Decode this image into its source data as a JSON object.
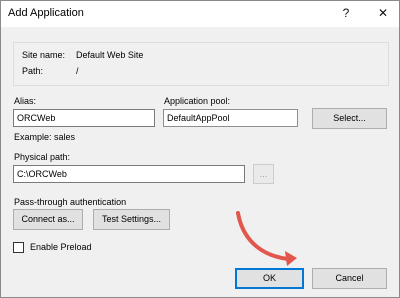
{
  "window": {
    "title": "Add Application",
    "help_glyph": "?",
    "close_glyph": "✕"
  },
  "site_info": {
    "site_name_label": "Site name:",
    "site_name_value": "Default Web Site",
    "path_label": "Path:",
    "path_value": "/"
  },
  "alias": {
    "label": "Alias:",
    "value": "ORCWeb",
    "example": "Example: sales"
  },
  "app_pool": {
    "label": "Application pool:",
    "value": "DefaultAppPool",
    "select_button": "Select..."
  },
  "physical_path": {
    "label": "Physical path:",
    "value": "C:\\ORCWeb",
    "browse_button": "..."
  },
  "auth": {
    "label": "Pass-through authentication",
    "connect_button": "Connect as...",
    "test_button": "Test Settings..."
  },
  "preload": {
    "label": "Enable Preload",
    "checked": false
  },
  "footer": {
    "ok_button": "OK",
    "cancel_button": "Cancel"
  },
  "colors": {
    "annotation_arrow": "#e2564b",
    "focus_border": "#0078d7"
  },
  "icons": {
    "help": "help-icon",
    "close": "close-icon",
    "annotation": "curved-arrow-annotation"
  }
}
